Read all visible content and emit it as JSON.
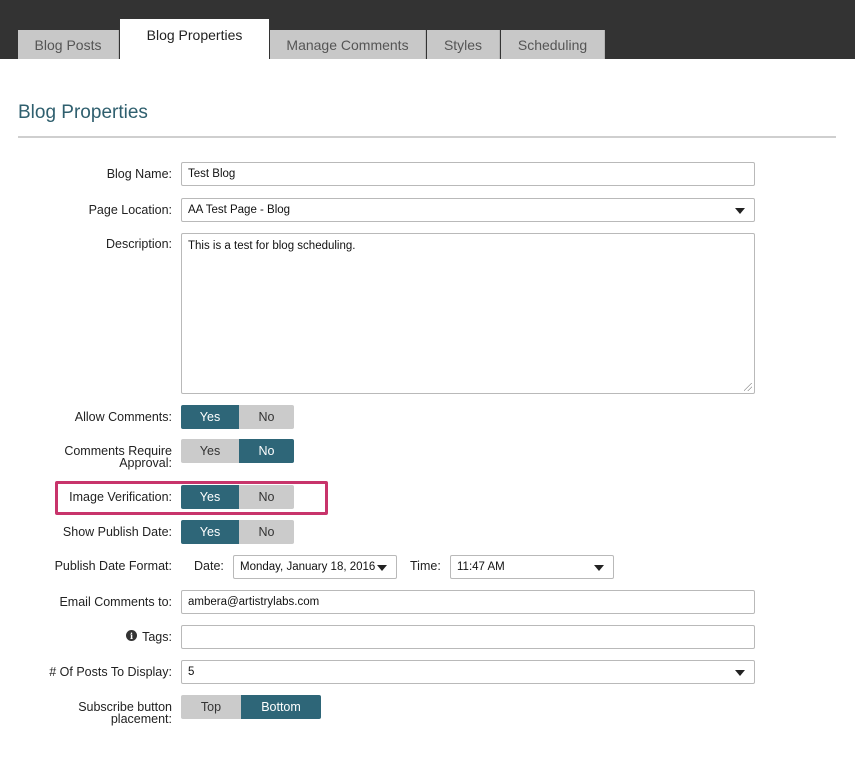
{
  "tabs": [
    {
      "label": "Blog Posts"
    },
    {
      "label": "Blog Properties"
    },
    {
      "label": "Manage Comments"
    },
    {
      "label": "Styles"
    },
    {
      "label": "Scheduling"
    }
  ],
  "page_title": "Blog Properties",
  "form": {
    "blog_name": {
      "label": "Blog Name:",
      "value": "Test Blog"
    },
    "page_location": {
      "label": "Page Location:",
      "value": "AA Test Page - Blog"
    },
    "description": {
      "label": "Description:",
      "value": "This is a test for blog scheduling."
    },
    "allow_comments": {
      "label": "Allow Comments:",
      "yes": "Yes",
      "no": "No",
      "selected": "Yes"
    },
    "require_approval": {
      "label_line1": "Comments Require",
      "label_line2": "Approval:",
      "yes": "Yes",
      "no": "No",
      "selected": "No"
    },
    "image_verification": {
      "label": "Image Verification:",
      "yes": "Yes",
      "no": "No",
      "selected": "Yes"
    },
    "show_publish_date": {
      "label": "Show Publish Date:",
      "yes": "Yes",
      "no": "No",
      "selected": "Yes"
    },
    "publish_date_format": {
      "label": "Publish Date Format:",
      "date_label": "Date:",
      "date_value": "Monday, January 18, 2016",
      "time_label": "Time:",
      "time_value": "11:47 AM"
    },
    "email_comments": {
      "label": "Email Comments to:",
      "value": "ambera@artistrylabs.com"
    },
    "tags": {
      "label": "Tags:",
      "value": "",
      "icon": "info-icon"
    },
    "posts_to_display": {
      "label": "# Of Posts To Display:",
      "value": "5"
    },
    "subscribe_placement": {
      "label_line1": "Subscribe button",
      "label_line2": "placement:",
      "top": "Top",
      "bottom": "Bottom",
      "selected": "Bottom"
    }
  },
  "colors": {
    "accent": "#2e6678",
    "toggle_off": "#cbcbcb",
    "highlight": "#c8346b",
    "title": "#2f5f6e",
    "topbar": "#333333"
  }
}
